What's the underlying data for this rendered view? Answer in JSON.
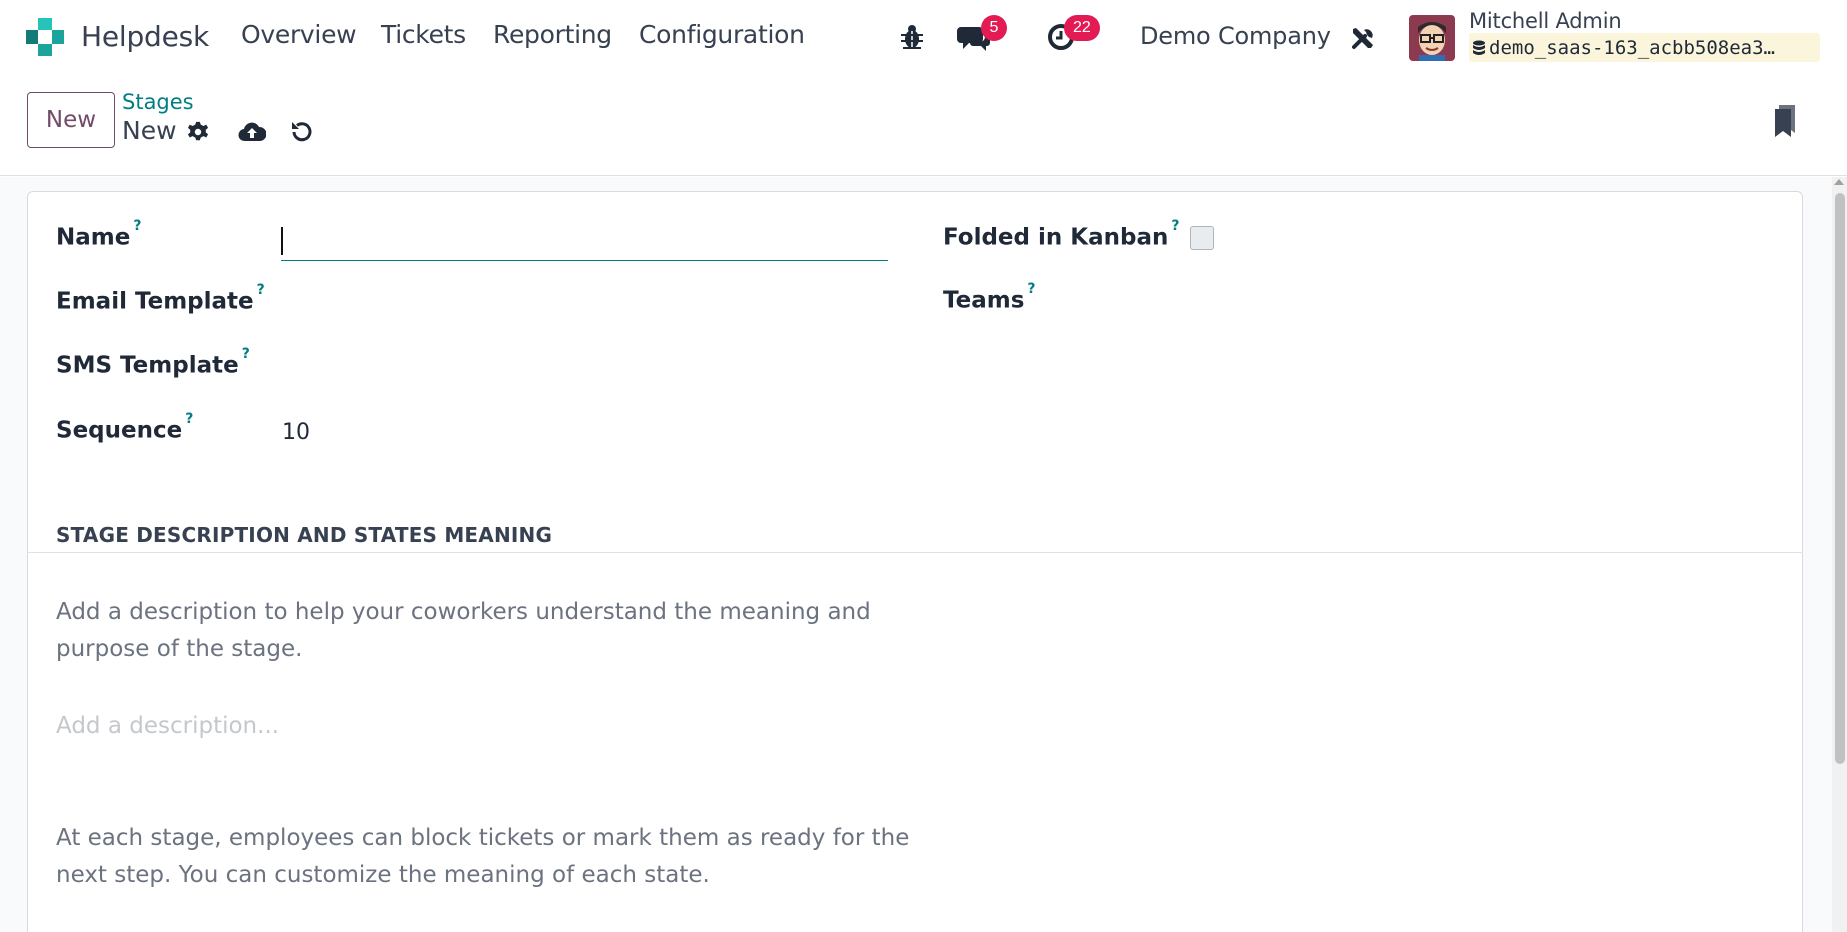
{
  "navbar": {
    "app_name": "Helpdesk",
    "menu": [
      "Overview",
      "Tickets",
      "Reporting",
      "Configuration"
    ],
    "messages_count": "5",
    "activities_count": "22",
    "company": "Demo Company",
    "user_name": "Mitchell Admin",
    "database": "demo_saas-163_acbb508ea3…",
    "icons": [
      "bug-icon",
      "chat-icon",
      "clock-icon",
      "tools-icon",
      "database-icon"
    ],
    "brand_color": "#1ba39c"
  },
  "control_panel": {
    "new_button": "New",
    "breadcrumb_parent": "Stages",
    "breadcrumb_current": "New",
    "icons": [
      "gear-icon",
      "cloud-upload-icon",
      "undo-icon",
      "bookmark-icon"
    ],
    "accent_color": "#714b67",
    "link_color": "#017e84"
  },
  "form": {
    "name_label": "Name",
    "name_value": "",
    "email_template_label": "Email Template",
    "sms_template_label": "SMS Template",
    "sequence_label": "Sequence",
    "sequence_value": "10",
    "folded_label": "Folded in Kanban",
    "folded_value": false,
    "teams_label": "Teams",
    "help_marker": "?"
  },
  "section": {
    "title": "STAGE DESCRIPTION AND STATES MEANING",
    "intro": "Add a description to help your coworkers understand the meaning and purpose of the stage.",
    "description_placeholder": "Add a description...",
    "states_text": "At each stage, employees can block tickets or mark them as ready for the next step. You can customize the meaning of each state."
  }
}
